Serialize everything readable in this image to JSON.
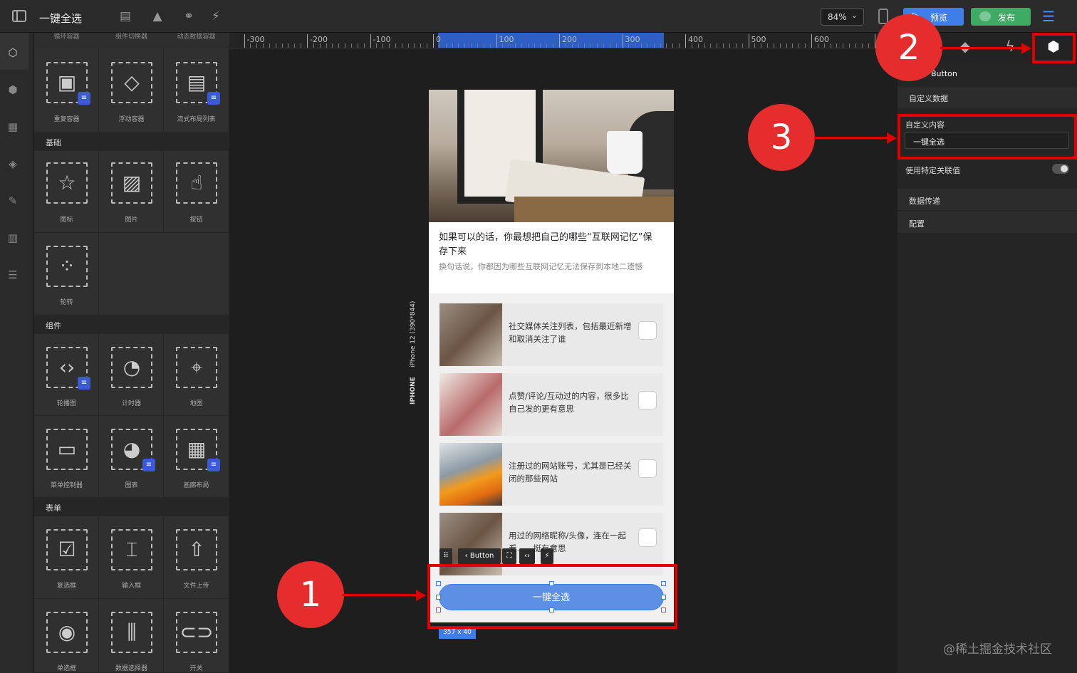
{
  "app": {
    "title": "一键全选"
  },
  "toolbar": {
    "zoom": "84%",
    "preview_label": "预览",
    "publish_label": "发布"
  },
  "panel": {
    "top_labels": [
      "循环容器",
      "组件切换器",
      "动态数据容器"
    ],
    "containers": [
      {
        "label": "重复容器",
        "icon": "repeat-container-icon",
        "db": true
      },
      {
        "label": "浮动容器",
        "icon": "float-container-icon",
        "db": false
      },
      {
        "label": "流式布局列表",
        "icon": "flow-layout-icon",
        "db": true
      }
    ],
    "basic_header": "基础",
    "basic": [
      {
        "label": "图标",
        "icon": "star-icon"
      },
      {
        "label": "图片",
        "icon": "image-icon"
      },
      {
        "label": "按钮",
        "icon": "button-icon"
      },
      {
        "label": "轮转",
        "icon": "spinner-icon"
      }
    ],
    "components_header": "组件",
    "components": [
      {
        "label": "轮播图",
        "icon": "carousel-icon",
        "db": true
      },
      {
        "label": "计时器",
        "icon": "timer-icon",
        "db": false
      },
      {
        "label": "地图",
        "icon": "map-icon",
        "db": false
      },
      {
        "label": "菜单控制器",
        "icon": "menu-controller-icon",
        "db": false
      },
      {
        "label": "图表",
        "icon": "chart-icon",
        "db": true
      },
      {
        "label": "画廊布局",
        "icon": "gallery-icon",
        "db": true
      }
    ],
    "form_header": "表单",
    "form": [
      {
        "label": "复选框",
        "icon": "checkbox-icon"
      },
      {
        "label": "输入框",
        "icon": "input-icon"
      },
      {
        "label": "文件上传",
        "icon": "upload-icon"
      },
      {
        "label": "单选框",
        "icon": "radio-icon"
      },
      {
        "label": "数据选择器",
        "icon": "data-picker-icon"
      },
      {
        "label": "开关",
        "icon": "switch-icon"
      }
    ]
  },
  "ruler": {
    "labels": [
      "-300",
      "-200",
      "-100",
      "0",
      "100",
      "200",
      "300",
      "400",
      "500",
      "600",
      "70"
    ]
  },
  "device": {
    "name": "IPHONE",
    "model": "iPhone 12 (390*844)"
  },
  "phone": {
    "title": "如果可以的话，你最想把自己的哪些“互联网记忆”保存下来",
    "subtitle": "换句话说，你都因为哪些互联网记忆无法保存到本地二遗憾",
    "items": [
      {
        "text": "社交媒体关注列表，包括最近新增和取消关注了谁"
      },
      {
        "text": "点赞/评论/互动过的内容，很多比自己发的更有意思"
      },
      {
        "text": "注册过的网站账号，尤其是已经关闭的那些网站"
      },
      {
        "text": "用过的网络昵称/头像，连在一起看……挺有意思"
      }
    ],
    "button_label": "一键全选",
    "component_toolbar_label": "Button",
    "size_badge": "357 x 40"
  },
  "annotations": [
    "1",
    "2",
    "3"
  ],
  "inspector": {
    "title": "Button",
    "custom_data": "自定义数据",
    "custom_content_label": "自定义内容",
    "custom_content_value": "一键全选",
    "use_specific_value": "使用特定关联值",
    "data_passing": "数据传递",
    "config": "配置"
  },
  "watermark": "@稀土掘金技术社区",
  "colors": {
    "accent": "#3d7ee8",
    "publish": "#3dab62",
    "annotation": "#e00000"
  }
}
